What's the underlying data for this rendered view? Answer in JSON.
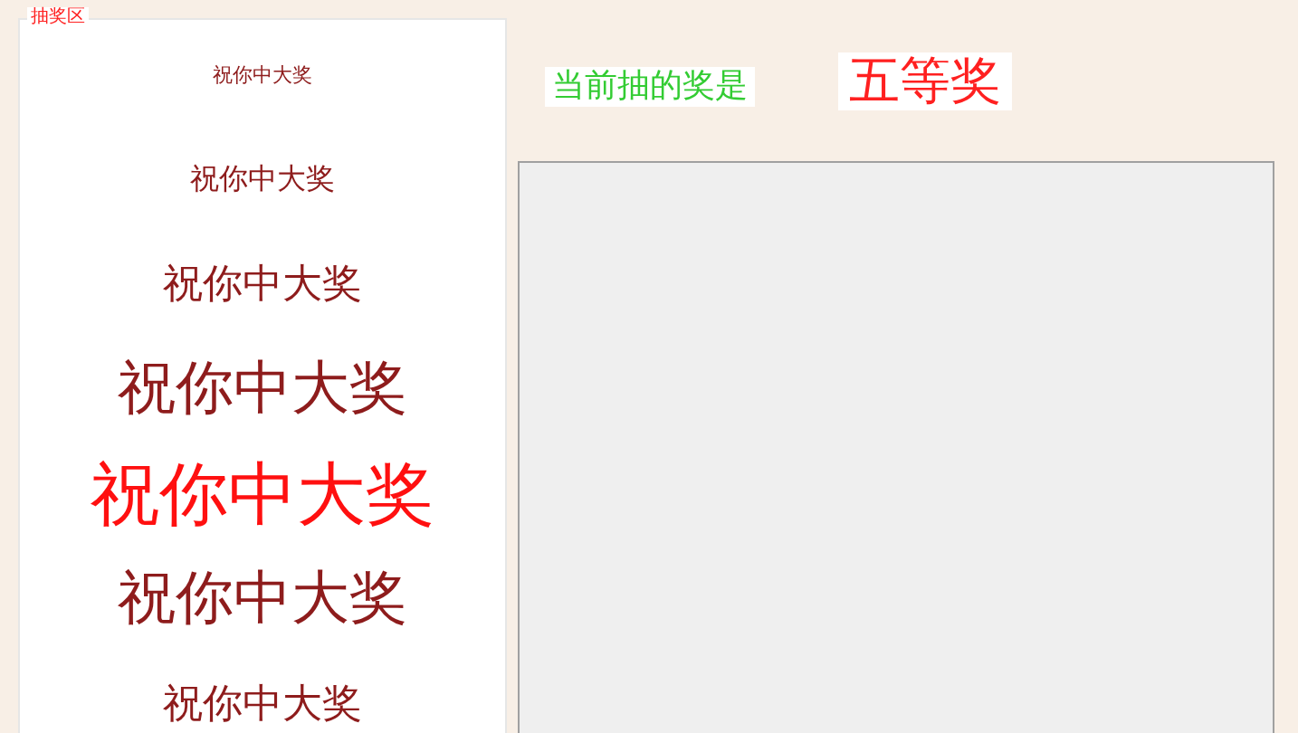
{
  "draw_panel": {
    "legend": "抽奖区",
    "items": [
      {
        "label": "祝你中大奖",
        "selected": false
      },
      {
        "label": "祝你中大奖",
        "selected": false
      },
      {
        "label": "祝你中大奖",
        "selected": false
      },
      {
        "label": "祝你中大奖",
        "selected": false
      },
      {
        "label": "祝你中大奖",
        "selected": true
      },
      {
        "label": "祝你中大奖",
        "selected": false
      },
      {
        "label": "祝你中大奖",
        "selected": false
      }
    ]
  },
  "current_prize": {
    "label": "当前抽的奖是",
    "value": "五等奖"
  }
}
